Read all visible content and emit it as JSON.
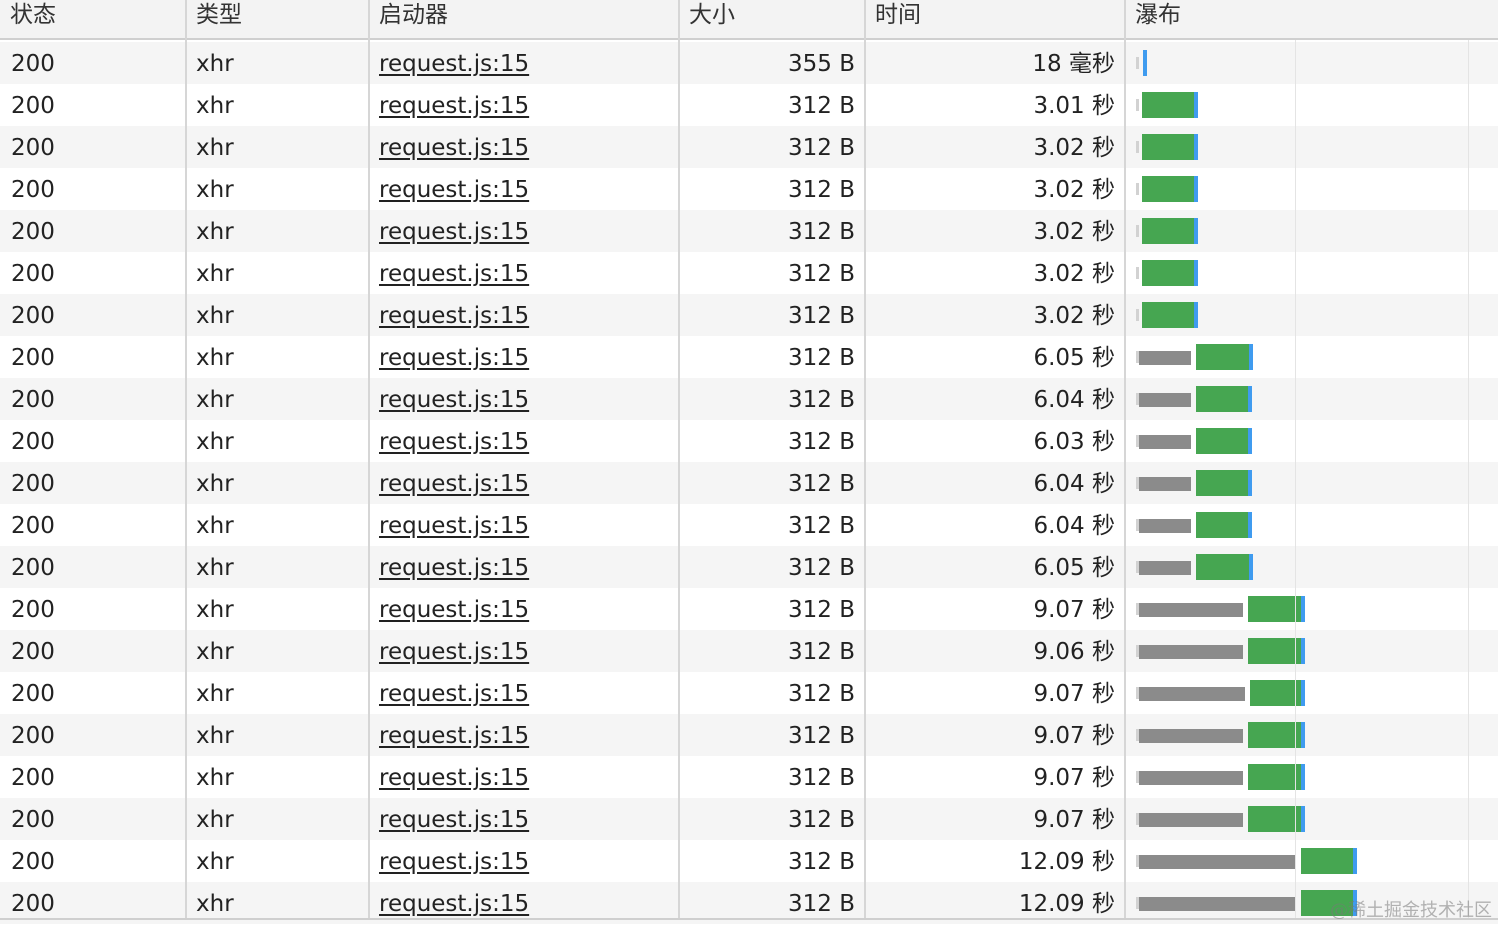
{
  "columns": {
    "status": "状态",
    "type": "类型",
    "initiator": "启动器",
    "size": "大小",
    "time": "时间",
    "waterfall": "瀑布"
  },
  "colors": {
    "waiting": "#8b8b8b",
    "receiving": "#46a651",
    "finished_marker": "#3f9bef"
  },
  "rows": [
    {
      "status": "200",
      "type": "xhr",
      "initiator": "request.js:15",
      "size": "355 B",
      "time": "18 毫秒",
      "waiting_s": 0.0,
      "receiving_s": 0.0
    },
    {
      "status": "200",
      "type": "xhr",
      "initiator": "request.js:15",
      "size": "312 B",
      "time": "3.01 秒",
      "waiting_s": 0.0,
      "receiving_s": 3.01
    },
    {
      "status": "200",
      "type": "xhr",
      "initiator": "request.js:15",
      "size": "312 B",
      "time": "3.02 秒",
      "waiting_s": 0.0,
      "receiving_s": 3.02
    },
    {
      "status": "200",
      "type": "xhr",
      "initiator": "request.js:15",
      "size": "312 B",
      "time": "3.02 秒",
      "waiting_s": 0.0,
      "receiving_s": 3.02
    },
    {
      "status": "200",
      "type": "xhr",
      "initiator": "request.js:15",
      "size": "312 B",
      "time": "3.02 秒",
      "waiting_s": 0.0,
      "receiving_s": 3.02
    },
    {
      "status": "200",
      "type": "xhr",
      "initiator": "request.js:15",
      "size": "312 B",
      "time": "3.02 秒",
      "waiting_s": 0.0,
      "receiving_s": 3.02
    },
    {
      "status": "200",
      "type": "xhr",
      "initiator": "request.js:15",
      "size": "312 B",
      "time": "3.02 秒",
      "waiting_s": 0.0,
      "receiving_s": 3.02
    },
    {
      "status": "200",
      "type": "xhr",
      "initiator": "request.js:15",
      "size": "312 B",
      "time": "6.05 秒",
      "waiting_s": 3.02,
      "receiving_s": 3.03
    },
    {
      "status": "200",
      "type": "xhr",
      "initiator": "request.js:15",
      "size": "312 B",
      "time": "6.04 秒",
      "waiting_s": 3.02,
      "receiving_s": 3.02
    },
    {
      "status": "200",
      "type": "xhr",
      "initiator": "request.js:15",
      "size": "312 B",
      "time": "6.03 秒",
      "waiting_s": 3.02,
      "receiving_s": 3.01
    },
    {
      "status": "200",
      "type": "xhr",
      "initiator": "request.js:15",
      "size": "312 B",
      "time": "6.04 秒",
      "waiting_s": 3.02,
      "receiving_s": 3.02
    },
    {
      "status": "200",
      "type": "xhr",
      "initiator": "request.js:15",
      "size": "312 B",
      "time": "6.04 秒",
      "waiting_s": 3.02,
      "receiving_s": 3.02
    },
    {
      "status": "200",
      "type": "xhr",
      "initiator": "request.js:15",
      "size": "312 B",
      "time": "6.05 秒",
      "waiting_s": 3.02,
      "receiving_s": 3.03
    },
    {
      "status": "200",
      "type": "xhr",
      "initiator": "request.js:15",
      "size": "312 B",
      "time": "9.07 秒",
      "waiting_s": 6.04,
      "receiving_s": 3.03
    },
    {
      "status": "200",
      "type": "xhr",
      "initiator": "request.js:15",
      "size": "312 B",
      "time": "9.06 秒",
      "waiting_s": 6.04,
      "receiving_s": 3.02
    },
    {
      "status": "200",
      "type": "xhr",
      "initiator": "request.js:15",
      "size": "312 B",
      "time": "9.07 秒",
      "waiting_s": 6.1,
      "receiving_s": 2.97
    },
    {
      "status": "200",
      "type": "xhr",
      "initiator": "request.js:15",
      "size": "312 B",
      "time": "9.07 秒",
      "waiting_s": 6.04,
      "receiving_s": 3.03
    },
    {
      "status": "200",
      "type": "xhr",
      "initiator": "request.js:15",
      "size": "312 B",
      "time": "9.07 秒",
      "waiting_s": 6.04,
      "receiving_s": 3.03
    },
    {
      "status": "200",
      "type": "xhr",
      "initiator": "request.js:15",
      "size": "312 B",
      "time": "9.07 秒",
      "waiting_s": 6.04,
      "receiving_s": 3.03
    },
    {
      "status": "200",
      "type": "xhr",
      "initiator": "request.js:15",
      "size": "312 B",
      "time": "12.09 秒",
      "waiting_s": 9.06,
      "receiving_s": 3.03
    },
    {
      "status": "200",
      "type": "xhr",
      "initiator": "request.js:15",
      "size": "312 B",
      "time": "12.09 秒",
      "waiting_s": 9.06,
      "receiving_s": 3.03
    }
  ],
  "watermark": "@稀土掘金技术社区"
}
